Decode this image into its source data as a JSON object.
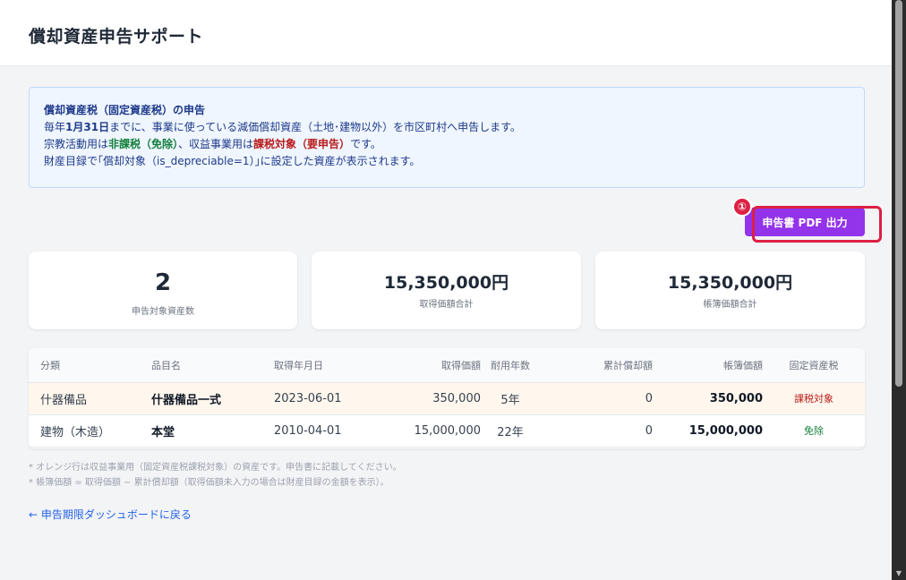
{
  "header": {
    "title": "償却資産申告サポート"
  },
  "info": {
    "title": "償却資産税（固定資産税）の申告",
    "line1_prefix": "毎年",
    "line1_date": "1月31日",
    "line1_suffix": "までに、事業に使っている減価償却資産（土地･建物以外）を市区町村へ申告します。",
    "line2_a": "宗教活動用は",
    "line2_nontax": "非課税（免除）",
    "line2_b": "、収益事業用は",
    "line2_tax": "課税対象（要申告）",
    "line2_c": "です。",
    "line3": "財産目録で｢償却対象（is_depreciable=1）｣に設定した資産が表示されます。"
  },
  "actions": {
    "pdf_label": "申告書 PDF 出力",
    "marker": "①"
  },
  "summary": [
    {
      "value": "2",
      "label": "申告対象資産数"
    },
    {
      "value": "15,350,000円",
      "label": "取得価額合計"
    },
    {
      "value": "15,350,000円",
      "label": "帳簿価額合計"
    }
  ],
  "table": {
    "headers": [
      "分類",
      "品目名",
      "取得年月日",
      "取得価額",
      "耐用年数",
      "累計償却額",
      "帳簿価額",
      "固定資産税"
    ],
    "rows": [
      {
        "category": "什器備品",
        "name": "什器備品一式",
        "date": "2023-06-01",
        "cost": "350,000",
        "life": "5年",
        "depreciation": "0",
        "book": "350,000",
        "tax": "課税対象"
      },
      {
        "category": "建物（木造）",
        "name": "本堂",
        "date": "2010-04-01",
        "cost": "15,000,000",
        "life": "22年",
        "depreciation": "0",
        "book": "15,000,000",
        "tax": "免除"
      }
    ]
  },
  "notes": [
    "* オレンジ行は収益事業用（固定資産税課税対象）の資産です。申告書に記載してください。",
    "* 帳簿価額 = 取得価額 − 累計償却額（取得価額未入力の場合は財産目録の金額を表示）。"
  ],
  "back_link": "← 申告期限ダッシュボードに戻る",
  "colors": {
    "accent": "#9333ea",
    "highlight": "#dc2043",
    "taxed_row": "#fff7ed",
    "link": "#2563eb"
  }
}
